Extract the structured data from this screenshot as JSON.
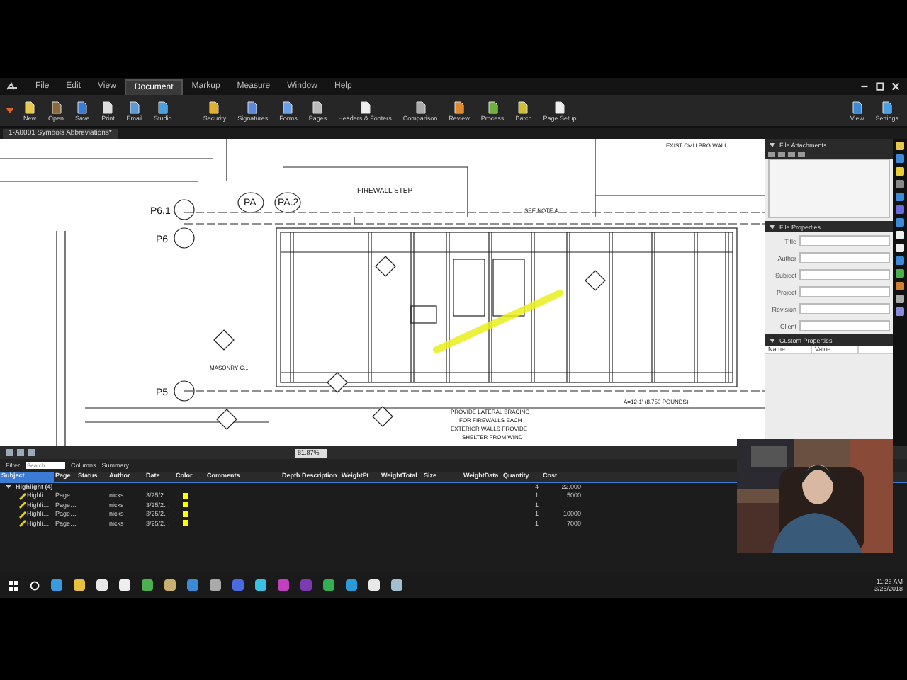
{
  "menu": [
    {
      "label": "File",
      "selected": false
    },
    {
      "label": "Edit",
      "selected": false
    },
    {
      "label": "View",
      "selected": false
    },
    {
      "label": "Document",
      "selected": true
    },
    {
      "label": "Markup",
      "selected": false
    },
    {
      "label": "Measure",
      "selected": false
    },
    {
      "label": "Window",
      "selected": false
    },
    {
      "label": "Help",
      "selected": false
    }
  ],
  "toolbar": {
    "file_tools": [
      "New",
      "Open",
      "Save",
      "Print",
      "Email",
      "Studio"
    ],
    "document_tools": [
      "Security",
      "Signatures",
      "Forms",
      "Pages",
      "Headers & Footers",
      "Comparison",
      "Review",
      "Process",
      "Batch",
      "Page Setup"
    ],
    "right_tools": [
      "View",
      "Settings"
    ]
  },
  "document_tab": {
    "title": "1-A0001 Symbols Abbreviations*"
  },
  "drawing": {
    "labels": [
      "PA",
      "PA.2",
      "FIREWALL STEP",
      "P6.1",
      "P6",
      "P5",
      "EXIST CMU BRG WALL",
      "SEE NOTE 4",
      "MASONRY C...",
      "A=12-1' (8,750 POUNDS)",
      "PROVIDE LATERAL BRACING",
      "FOR FIREWALLS EACH",
      "EXTERIOR WALLS PROVIDE",
      "SHELTER FROM WIND"
    ]
  },
  "navigation": {
    "zoom": "81.87%"
  },
  "properties_panel": {
    "sections": [
      {
        "title": "File Attachments",
        "expanded": true
      },
      {
        "title": "File Properties",
        "expanded": true
      },
      {
        "title": "Custom Properties",
        "expanded": true
      }
    ],
    "fields": [
      "Title",
      "Author",
      "Subject",
      "Project",
      "Revision",
      "Client"
    ],
    "custom_columns": [
      "Name",
      "Value"
    ]
  },
  "markups": {
    "toolbar": {
      "filter": "Filter",
      "search_placeholder": "Search",
      "columns": "Columns",
      "summary": "Summary"
    },
    "columns": [
      "Subject",
      "Page",
      "Status",
      "Author",
      "Date",
      "Color",
      "Comments",
      "Depth",
      "Description",
      "WeightFt",
      "WeightTotal",
      "Size",
      "WeightData",
      "Quantity",
      "Cost"
    ],
    "group": {
      "label": "Highlight (4)",
      "expanded": true,
      "quantity": "4",
      "cost": "22,000"
    },
    "rows": [
      {
        "subject": "Highli…",
        "page": "Page…",
        "author": "nicks",
        "date": "3/25/2…",
        "color": "#ffff00",
        "quantity": "1",
        "cost": "5000"
      },
      {
        "subject": "Highli…",
        "page": "Page…",
        "author": "nicks",
        "date": "3/25/2…",
        "color": "#ffff00",
        "quantity": "1",
        "cost": ""
      },
      {
        "subject": "Highli…",
        "page": "Page…",
        "author": "nicks",
        "date": "3/25/2…",
        "color": "#ffff00",
        "quantity": "1",
        "cost": "10000"
      },
      {
        "subject": "Highli…",
        "page": "Page…",
        "author": "nicks",
        "date": "3/25/2…",
        "color": "#ffff00",
        "quantity": "1",
        "cost": "7000"
      }
    ]
  },
  "taskbar": {
    "time": "11:28 AM",
    "date": "3/25/2018"
  }
}
